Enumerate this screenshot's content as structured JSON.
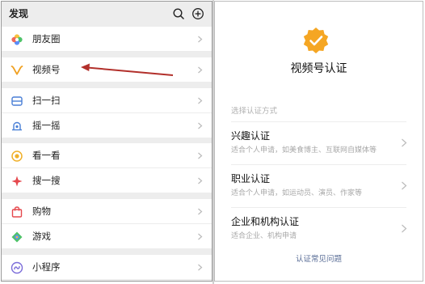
{
  "discover": {
    "title": "发现",
    "header_icons": [
      "search-icon",
      "add-circle-icon"
    ],
    "items": [
      {
        "label": "朋友圈",
        "icon": "moments-icon"
      },
      {
        "label": "视频号",
        "icon": "channels-icon"
      },
      {
        "label": "扫一扫",
        "icon": "scan-icon"
      },
      {
        "label": "摇一摇",
        "icon": "shake-icon"
      },
      {
        "label": "看一看",
        "icon": "top-stories-icon"
      },
      {
        "label": "搜一搜",
        "icon": "search-star-icon"
      },
      {
        "label": "购物",
        "icon": "shopping-bag-icon"
      },
      {
        "label": "游戏",
        "icon": "game-icon"
      },
      {
        "label": "小程序",
        "icon": "mini-programs-icon"
      }
    ],
    "annotation": "red-arrow pointing to 视频号"
  },
  "verification": {
    "badge": "verified-badge-icon",
    "title": "视频号认证",
    "choose_label": "选择认证方式",
    "options": [
      {
        "title": "兴趣认证",
        "desc": "适合个人申请，如美食博主、互联网自媒体等"
      },
      {
        "title": "职业认证",
        "desc": "适合个人申请，如运动员、演员、作家等"
      },
      {
        "title": "企业和机构认证",
        "desc": "适合企业、机构申请"
      }
    ],
    "faq_link": "认证常见问题"
  },
  "colors": {
    "accent_orange": "#f5a623",
    "link_blue": "#576b95",
    "annotation_red": "#b2302b"
  }
}
